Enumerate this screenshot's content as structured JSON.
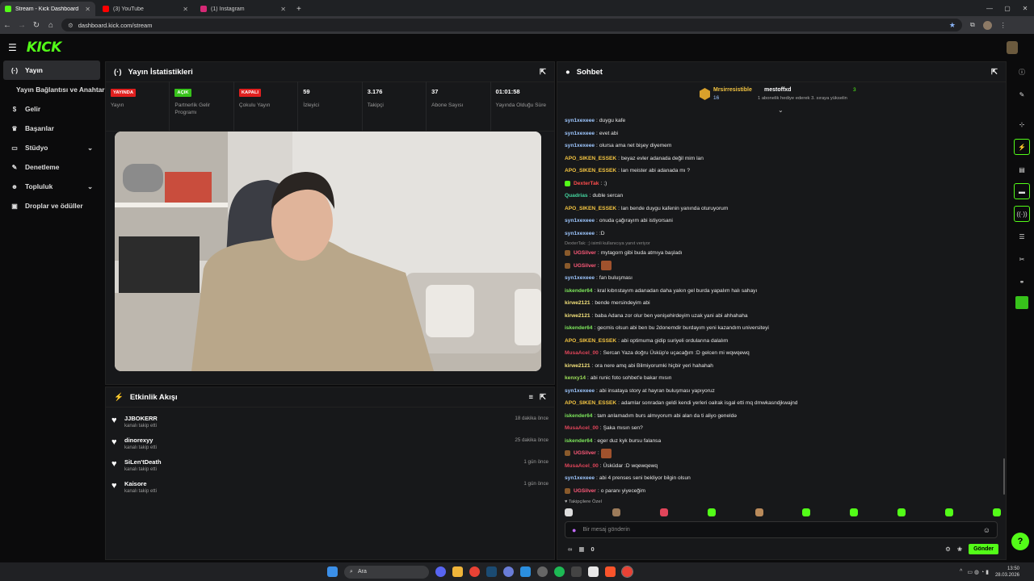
{
  "browser": {
    "tabs": [
      {
        "title": "Stream - Kick Dashboard",
        "color": "#53fc18",
        "active": true
      },
      {
        "title": "(3) YouTube",
        "color": "#ff0000",
        "active": false
      },
      {
        "title": "(1) Instagram",
        "color": "#d62976",
        "active": false
      }
    ],
    "url": "dashboard.kick.com/stream"
  },
  "brand": {
    "logo": "KICK",
    "accent": "#53fc18"
  },
  "sidebar": {
    "items": [
      {
        "label": "Yayın",
        "icon": "broadcast-icon"
      },
      {
        "label": "Yayın Bağlantısı ve Anahtarı",
        "icon": ""
      },
      {
        "label": "Gelir",
        "icon": "money-icon"
      },
      {
        "label": "Başarılar",
        "icon": "trophy-icon"
      },
      {
        "label": "Stüdyo",
        "icon": "studio-icon"
      },
      {
        "label": "Denetleme",
        "icon": "wrench-icon"
      },
      {
        "label": "Topluluk",
        "icon": "community-icon"
      },
      {
        "label": "Droplar ve ödüller",
        "icon": "gift-icon"
      }
    ]
  },
  "stats_panel": {
    "title": "Yayın İstatistikleri",
    "stats": [
      {
        "badge": "YAYINDA",
        "badge_color": "#e0201f",
        "label": "Yayın"
      },
      {
        "badge": "AÇIK",
        "badge_color": "#37c21b",
        "label": "Partnerlik Gelir Programı"
      },
      {
        "badge": "KAPALI",
        "badge_color": "#e0201f",
        "label": "Çokulu Yayın"
      },
      {
        "value": "59",
        "label": "İzleyici"
      },
      {
        "value": "3.176",
        "label": "Takipçi"
      },
      {
        "value": "37",
        "label": "Abone Sayısı"
      },
      {
        "value": "01:01:58",
        "label": "Yayında Olduğu Süre"
      }
    ]
  },
  "activity": {
    "title": "Etkinlik Akışı",
    "items": [
      {
        "name": "JJBOKERR",
        "action": "kanalı takip etti",
        "time": "18 dakika önce"
      },
      {
        "name": "dinorexyy",
        "action": "kanalı takip etti",
        "time": "25 dakika önce"
      },
      {
        "name": "SiLen'tDeath",
        "action": "kanalı takip etti",
        "time": "1 gün önce"
      },
      {
        "name": "Kaisore",
        "action": "kanalı takip etti",
        "time": "1 gün önce"
      }
    ]
  },
  "chat": {
    "title": "Sohbet",
    "pinned": {
      "user1": "Mrsirresistible",
      "count1": "16",
      "user2": "mestoffxd",
      "count2": "3",
      "note": "1 abonelik hediye ederek 3. sıraya yükselin"
    },
    "messages": [
      {
        "user": "syn1xexeee",
        "color": "#9ec7ff",
        "text": "duygu kafe"
      },
      {
        "user": "syn1xexeee",
        "color": "#9ec7ff",
        "text": "evet abi"
      },
      {
        "user": "syn1xexeee",
        "color": "#9ec7ff",
        "text": "olursa ama net bişey diyemem"
      },
      {
        "user": "APO_SIKEN_ESSEK",
        "color": "#f4c542",
        "text": "beyaz evler adanada değil mim lan"
      },
      {
        "user": "APO_SIKEN_ESSEK",
        "color": "#f4c542",
        "text": "lan meister abi adanada mı ?"
      },
      {
        "user": "DexterTak",
        "color": "#ff4d4d",
        "text": ";)",
        "badge": "#53fc18"
      },
      {
        "user": "Quadrias",
        "color": "#45d6a0",
        "text": "duble sercan"
      },
      {
        "user": "APO_SIKEN_ESSEK",
        "color": "#f4c542",
        "text": "lan bende duygu kafenin yanında oturuyorum"
      },
      {
        "user": "syn1xexeee",
        "color": "#9ec7ff",
        "text": "onuda çağırayım abi istiyorsani"
      },
      {
        "user": "syn1xexeee",
        "color": "#9ec7ff",
        "text": ":D"
      },
      {
        "reply": "DexterTak: ;) isimli kullanıcıya yanıt veriyor"
      },
      {
        "user": "UGSilver",
        "color": "#ff5a7a",
        "text": "mytagorn gibi buda atmıya başladı",
        "badge": "#8a5a2b"
      },
      {
        "user": "UGSilver",
        "color": "#ff5a7a",
        "text": "",
        "badge": "#8a5a2b",
        "emote": true
      },
      {
        "user": "syn1xexeee",
        "color": "#9ec7ff",
        "text": "fan buluşması"
      },
      {
        "user": "iskender64",
        "color": "#7ee85c",
        "text": "kral kıbrıstayım adanadan daha yakın gel burda yapalım halı sahayı"
      },
      {
        "user": "kirwe2121",
        "color": "#f2e07a",
        "text": "bende mersindeyim abi"
      },
      {
        "user": "kirwe2121",
        "color": "#f2e07a",
        "text": "baba Adana zor olur ben yenişehirdeyim uzak yani abi ahhahaha"
      },
      {
        "user": "iskender64",
        "color": "#7ee85c",
        "text": "gecmis olsun abi ben bu 2donemdir burdayım yeni kazandım universiteyi"
      },
      {
        "user": "APO_SIKEN_ESSEK",
        "color": "#f4c542",
        "text": "abi optimuma gidip suriyeli ordularına dalalım"
      },
      {
        "user": "MusaAcel_00",
        "color": "#e0455a",
        "text": "Sercan Yaza doğru Üsküp'e uçacağım :D gelcen mi wqwqewq"
      },
      {
        "user": "kirwe2121",
        "color": "#f2e07a",
        "text": "ora nere amq abi Bilmiyorumki hiçbir yeri hahahah"
      },
      {
        "user": "kenxy14",
        "color": "#9ee05a",
        "text": "abi runic foto sohbet'e bakar mısın"
      },
      {
        "user": "syn1xexeee",
        "color": "#9ec7ff",
        "text": "abi insataya story at hayran buluşması yapıyoruz"
      },
      {
        "user": "APO_SIKEN_ESSEK",
        "color": "#f4c542",
        "text": "adamlar sonradan geldi kendi yerleri oalrak isgal etti mq dmwkasndjkwajnd"
      },
      {
        "user": "iskender64",
        "color": "#7ee85c",
        "text": "tam anlamadım burs almıyorum abi alan da ti aliyo geneldə"
      },
      {
        "user": "MusaAcel_00",
        "color": "#e0455a",
        "text": "Şaka mısın sen?"
      },
      {
        "user": "iskender64",
        "color": "#7ee85c",
        "text": "eger duz kyk bursu falansa"
      },
      {
        "user": "UGSilver",
        "color": "#ff5a7a",
        "text": "",
        "badge": "#8a5a2b",
        "emote": true
      },
      {
        "user": "MusaAcel_00",
        "color": "#e0455a",
        "text": "Üsküdar :D wqewqewq"
      },
      {
        "user": "syn1xexeee",
        "color": "#9ec7ff",
        "text": "abi 4 prenses seni bekliyor bilgin olsun"
      },
      {
        "user": "UGSilver",
        "color": "#ff5a7a",
        "text": "o paranı yiyeceğim",
        "badge": "#8a5a2b"
      }
    ],
    "followers_only": "Takipçilere Özel",
    "input_placeholder": "Bir mesaj gönderin",
    "points": "0",
    "send_label": "Gönder"
  },
  "taskbar": {
    "search": "Ara",
    "time": "13:50",
    "date": "28.03.2026"
  }
}
